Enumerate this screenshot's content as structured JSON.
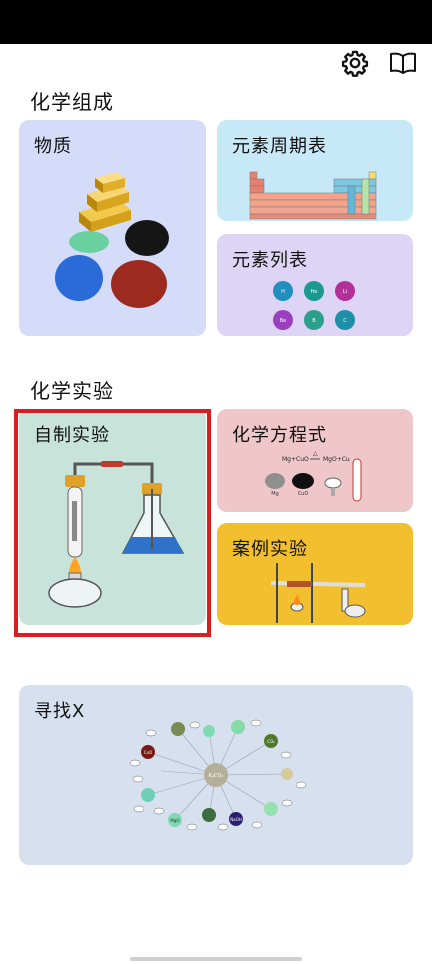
{
  "header": {
    "settings_icon": "gear-icon",
    "book_icon": "open-book-icon"
  },
  "sections": {
    "composition_title": "化学组成",
    "experiments_title": "化学实验"
  },
  "cards": {
    "substance": "物质",
    "periodic_table": "元素周期表",
    "element_list": "元素列表",
    "custom_experiment": "自制实验",
    "equation": "化学方程式",
    "case_experiment": "案例实验",
    "find_x": "寻找X"
  },
  "element_list_art": {
    "row1": [
      "H",
      "He",
      "Li"
    ],
    "row2": [
      "Be",
      "B",
      "C"
    ]
  },
  "equation_art": {
    "equation": "Mg+CuO",
    "arrow_condition": "△",
    "products": "MgO+Cu",
    "label_mg": "Mg",
    "label_cuo": "CuO"
  },
  "find_x_art": {
    "center": "K₂CO₃",
    "co2": "CO₂",
    "cuo": "CuO",
    "mgo": "MgO",
    "naoh": "NaOH"
  },
  "colors": {
    "substance_bg": "#d4dcfa",
    "periodic_bg": "#c7e8f7",
    "element_list_bg": "#ddd4f6",
    "custom_bg": "#c8e3da",
    "equation_bg": "#efc7cb",
    "case_bg": "#f2c02f",
    "findx_bg": "#d6e0ef",
    "highlight": "#d81e1e"
  }
}
